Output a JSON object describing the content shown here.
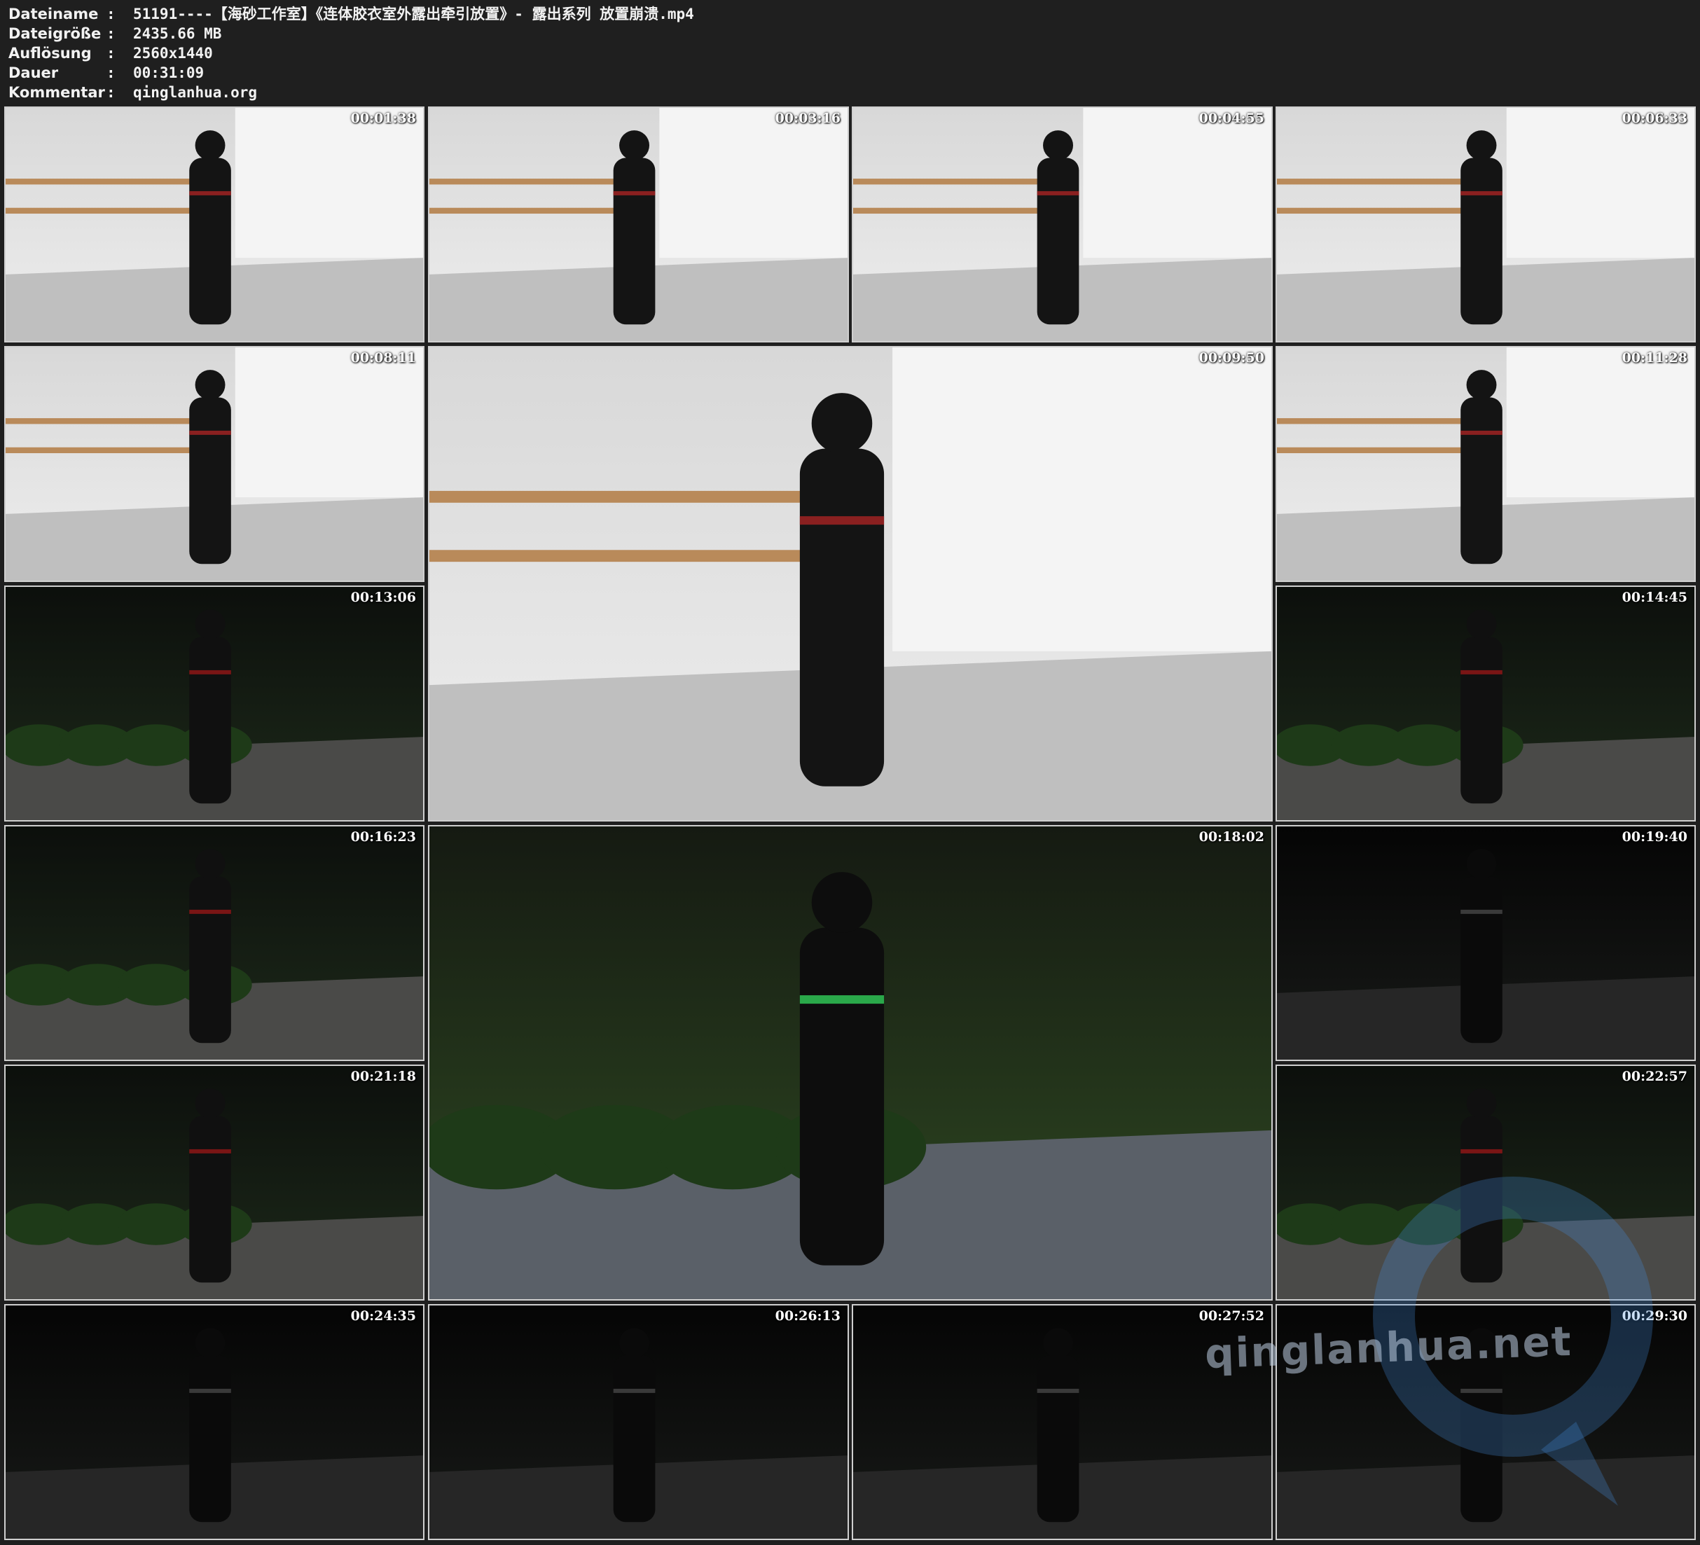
{
  "file_info": [
    {
      "label": "Dateiname",
      "sep": ":",
      "value": "51191----【海砂工作室】《连体胶衣室外露出牵引放置》- 露出系列 放置崩溃.mp4"
    },
    {
      "label": "Dateigröße",
      "sep": ":",
      "value": "2435.66 MB"
    },
    {
      "label": "Auflösung",
      "sep": ":",
      "value": "2560x1440"
    },
    {
      "label": "Dauer",
      "sep": ":",
      "value": "00:31:09"
    },
    {
      "label": "Kommentar",
      "sep": ":",
      "value": "qinglanhua.org"
    }
  ],
  "thumbnails": [
    {
      "timestamp": "00:01:38",
      "scene": "indoor"
    },
    {
      "timestamp": "00:03:16",
      "scene": "indoor"
    },
    {
      "timestamp": "00:04:55",
      "scene": "indoor"
    },
    {
      "timestamp": "00:06:33",
      "scene": "indoor"
    },
    {
      "timestamp": "00:08:11",
      "scene": "indoor"
    },
    {
      "timestamp": "00:09:50",
      "scene": "indoor"
    },
    {
      "timestamp": "00:11:28",
      "scene": "indoor"
    },
    {
      "timestamp": "00:13:06",
      "scene": "night"
    },
    {
      "timestamp": "00:14:45",
      "scene": "night"
    },
    {
      "timestamp": "00:16:23",
      "scene": "night"
    },
    {
      "timestamp": "00:18:02",
      "scene": "night-lit"
    },
    {
      "timestamp": "00:19:40",
      "scene": "dark"
    },
    {
      "timestamp": "00:21:18",
      "scene": "night"
    },
    {
      "timestamp": "00:22:57",
      "scene": "night"
    },
    {
      "timestamp": "00:24:35",
      "scene": "dark"
    },
    {
      "timestamp": "00:26:13",
      "scene": "dark"
    },
    {
      "timestamp": "00:27:52",
      "scene": "dark"
    },
    {
      "timestamp": "00:29:30",
      "scene": "dark"
    }
  ],
  "watermark_text": "qinglanhua.net"
}
